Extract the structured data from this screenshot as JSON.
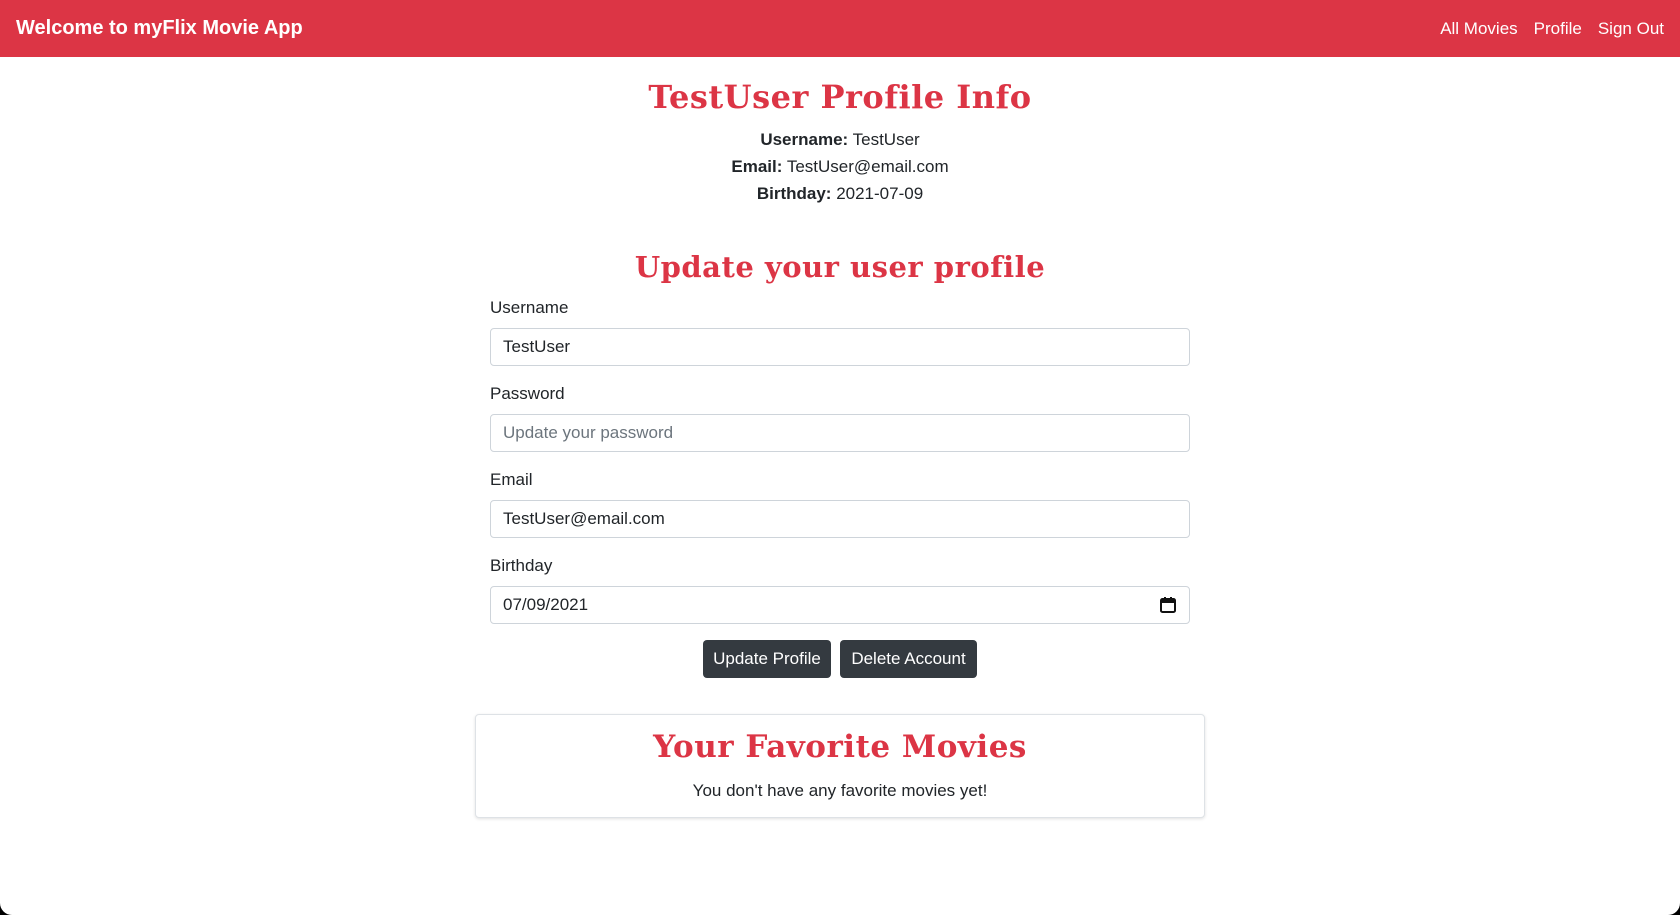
{
  "navbar": {
    "brand": "Welcome to myFlix Movie App",
    "links": [
      "All Movies",
      "Profile",
      "Sign Out"
    ],
    "color": "#dc3545"
  },
  "profile_info": {
    "title": "TestUser Profile Info",
    "username_label": "Username:",
    "username_value": "TestUser",
    "email_label": "Email:",
    "email_value": "TestUser@email.com",
    "birthday_label": "Birthday:",
    "birthday_value": "2021-07-09"
  },
  "update_form": {
    "title": "Update your user profile",
    "username": {
      "label": "Username",
      "value": "TestUser"
    },
    "password": {
      "label": "Password",
      "value": "",
      "placeholder": "Update your password"
    },
    "email": {
      "label": "Email",
      "value": "TestUser@email.com"
    },
    "birthday": {
      "label": "Birthday",
      "value": "07/09/2021",
      "icon": "calendar-icon"
    },
    "update_button": "Update Profile",
    "delete_button": "Delete Account"
  },
  "favorites": {
    "title": "Your Favorite Movies",
    "empty_message": "You don't have any favorite movies yet!"
  }
}
